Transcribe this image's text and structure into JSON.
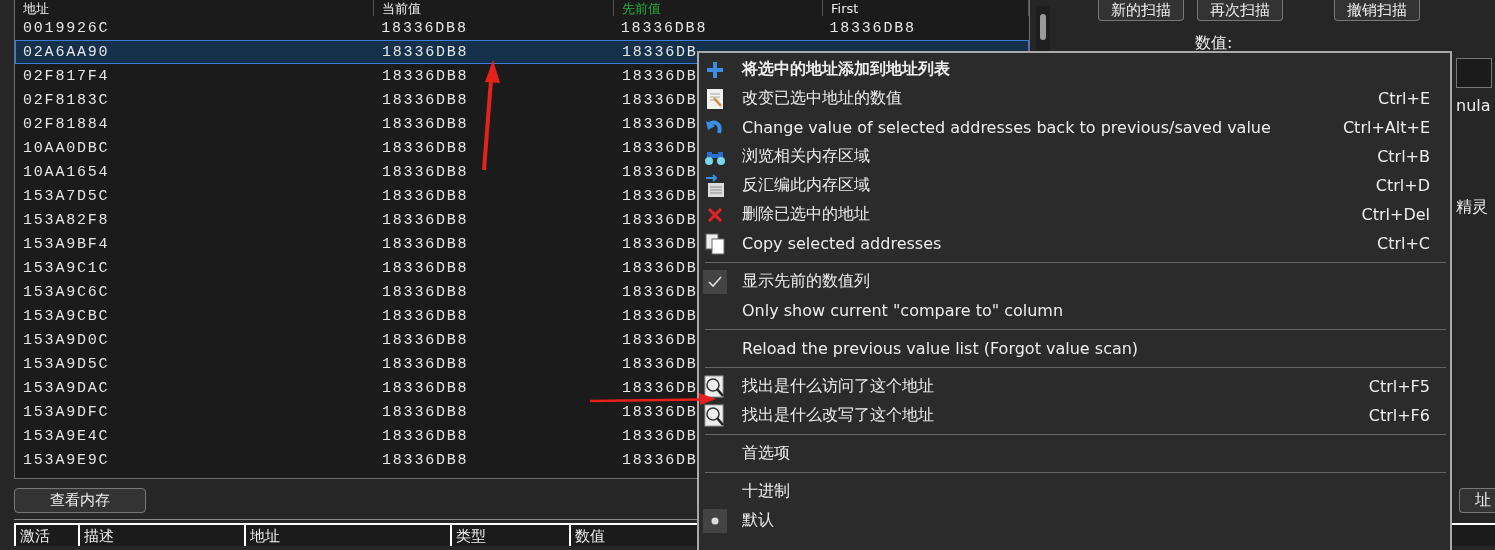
{
  "scan_list": {
    "columns": [
      {
        "label": "地址",
        "kind": "plain"
      },
      {
        "label": "当前值",
        "kind": "plain"
      },
      {
        "label": "先前值",
        "kind": "previous"
      },
      {
        "label": "First",
        "kind": "plain"
      }
    ],
    "rows": [
      {
        "cells": [
          "0019926C",
          "18336DB8",
          "18336DB8",
          "18336DB8"
        ],
        "selected": false
      },
      {
        "cells": [
          "02A6AA90",
          "18336DB8",
          "18336DB"
        ],
        "selected": true
      },
      {
        "cells": [
          "02F817F4",
          "18336DB8",
          "18336DB"
        ],
        "selected": false
      },
      {
        "cells": [
          "02F8183C",
          "18336DB8",
          "18336DB"
        ],
        "selected": false
      },
      {
        "cells": [
          "02F81884",
          "18336DB8",
          "18336DB"
        ],
        "selected": false
      },
      {
        "cells": [
          "10AA0DBC",
          "18336DB8",
          "18336DB"
        ],
        "selected": false
      },
      {
        "cells": [
          "10AA1654",
          "18336DB8",
          "18336DB"
        ],
        "selected": false
      },
      {
        "cells": [
          "153A7D5C",
          "18336DB8",
          "18336DB"
        ],
        "selected": false
      },
      {
        "cells": [
          "153A82F8",
          "18336DB8",
          "18336DB"
        ],
        "selected": false
      },
      {
        "cells": [
          "153A9BF4",
          "18336DB8",
          "18336DB"
        ],
        "selected": false
      },
      {
        "cells": [
          "153A9C1C",
          "18336DB8",
          "18336DB"
        ],
        "selected": false
      },
      {
        "cells": [
          "153A9C6C",
          "18336DB8",
          "18336DB"
        ],
        "selected": false
      },
      {
        "cells": [
          "153A9CBC",
          "18336DB8",
          "18336DB"
        ],
        "selected": false
      },
      {
        "cells": [
          "153A9D0C",
          "18336DB8",
          "18336DB"
        ],
        "selected": false
      },
      {
        "cells": [
          "153A9D5C",
          "18336DB8",
          "18336DB"
        ],
        "selected": false
      },
      {
        "cells": [
          "153A9DAC",
          "18336DB8",
          "18336DB"
        ],
        "selected": false
      },
      {
        "cells": [
          "153A9DFC",
          "18336DB8",
          "18336DB"
        ],
        "selected": false
      },
      {
        "cells": [
          "153A9E4C",
          "18336DB8",
          "18336DB"
        ],
        "selected": false
      },
      {
        "cells": [
          "153A9E9C",
          "18336DB8",
          "18336DB"
        ],
        "selected": false
      }
    ]
  },
  "scan_buttons": [
    "新的扫描",
    "再次扫描",
    "撤销扫描"
  ],
  "value_label": "数值:",
  "formula_text": "nula",
  "wizard_text": "精灵",
  "view_memory_button": "查看内存",
  "address_button": "址",
  "address_list": {
    "columns": [
      "激活",
      "描述",
      "地址",
      "类型",
      "数值"
    ]
  },
  "context_menu": [
    {
      "kind": "add",
      "label": "将选中的地址添加到地址列表",
      "bold": true
    },
    {
      "kind": "edit",
      "label": "改变已选中地址的数值",
      "shortcut": "Ctrl+E"
    },
    {
      "kind": "undo",
      "label": "Change value of selected addresses back to previous/saved value",
      "shortcut": "Ctrl+Alt+E"
    },
    {
      "kind": "browse",
      "label": "浏览相关内存区域",
      "shortcut": "Ctrl+B"
    },
    {
      "kind": "disassemble",
      "label": "反汇编此内存区域",
      "shortcut": "Ctrl+D"
    },
    {
      "kind": "delete",
      "label": "删除已选中的地址",
      "shortcut": "Ctrl+Del"
    },
    {
      "kind": "copy",
      "label": "Copy selected addresses",
      "shortcut": "Ctrl+C"
    },
    {
      "kind": "separator"
    },
    {
      "kind": "check",
      "label": "显示先前的数值列",
      "checked": true
    },
    {
      "kind": "check",
      "label": "Only show current \"compare to\" column",
      "checked": false
    },
    {
      "kind": "separator"
    },
    {
      "kind": "plain",
      "label": "Reload the previous value list (Forgot value scan)"
    },
    {
      "kind": "separator"
    },
    {
      "kind": "find",
      "label": "找出是什么访问了这个地址",
      "shortcut": "Ctrl+F5"
    },
    {
      "kind": "find",
      "label": "找出是什么改写了这个地址",
      "shortcut": "Ctrl+F6"
    },
    {
      "kind": "separator"
    },
    {
      "kind": "plain",
      "label": "首选项"
    },
    {
      "kind": "separator"
    },
    {
      "kind": "plain",
      "label": "十进制"
    },
    {
      "kind": "radio",
      "label": "默认",
      "selected": true
    }
  ]
}
